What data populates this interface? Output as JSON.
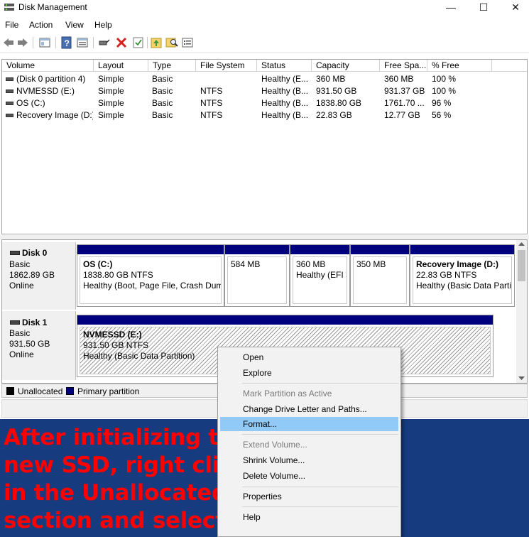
{
  "window": {
    "title": "Disk Management",
    "minimize": "—",
    "maximize": "☐",
    "close": "✕"
  },
  "menu": [
    "File",
    "Action",
    "View",
    "Help"
  ],
  "toolbar": {
    "icons": [
      "back-arrow-icon",
      "forward-arrow-icon",
      "show-hide-console-icon",
      "help-icon",
      "properties-icon",
      "connect-icon",
      "delete-icon",
      "check-icon",
      "up-arrow-icon",
      "search-icon",
      "list-icon"
    ]
  },
  "volume_table": {
    "columns": [
      "Volume",
      "Layout",
      "Type",
      "File System",
      "Status",
      "Capacity",
      "Free Spa...",
      "% Free"
    ],
    "rows": [
      [
        "(Disk 0 partition 4)",
        "Simple",
        "Basic",
        "",
        "Healthy (E...",
        "360 MB",
        "360 MB",
        "100 %"
      ],
      [
        "NVMESSD (E:)",
        "Simple",
        "Basic",
        "NTFS",
        "Healthy (B...",
        "931.50 GB",
        "931.37 GB",
        "100 %"
      ],
      [
        "OS (C:)",
        "Simple",
        "Basic",
        "NTFS",
        "Healthy (B...",
        "1838.80 GB",
        "1761.70 ...",
        "96 %"
      ],
      [
        "Recovery Image (D:)",
        "Simple",
        "Basic",
        "NTFS",
        "Healthy (B...",
        "22.83 GB",
        "12.77 GB",
        "56 %"
      ]
    ]
  },
  "disks": [
    {
      "name": "Disk 0",
      "type": "Basic",
      "size": "1862.89 GB",
      "state": "Online",
      "partitions": [
        {
          "line1": "OS  (C:)",
          "line2": "1838.80 GB NTFS",
          "line3": "Healthy (Boot, Page File, Crash Dump"
        },
        {
          "line1": "",
          "line2": "584 MB",
          "line3": ""
        },
        {
          "line1": "",
          "line2": "360 MB",
          "line3": "Healthy (EFI S"
        },
        {
          "line1": "",
          "line2": "350 MB",
          "line3": ""
        },
        {
          "line1": "Recovery Image  (D:)",
          "line2": "22.83 GB NTFS",
          "line3": "Healthy (Basic Data Partit"
        }
      ]
    },
    {
      "name": "Disk 1",
      "type": "Basic",
      "size": "931.50 GB",
      "state": "Online",
      "partitions": [
        {
          "line1": "NVMESSD  (E:)",
          "line2": "931.50 GB NTFS",
          "line3": "Healthy (Basic Data Partition)"
        }
      ]
    }
  ],
  "legend": {
    "unallocated": "Unallocated",
    "primary": "Primary partition",
    "unallocated_color": "#000000",
    "primary_color": "#00007e"
  },
  "context_menu": [
    {
      "label": "Open",
      "enabled": true
    },
    {
      "label": "Explore",
      "enabled": true
    },
    {
      "label": "Mark Partition as Active",
      "enabled": false
    },
    {
      "label": "Change Drive Letter and Paths...",
      "enabled": true
    },
    {
      "label": "Format...",
      "enabled": true,
      "highlighted": true
    },
    {
      "label": "Extend Volume...",
      "enabled": false
    },
    {
      "label": "Shrink Volume...",
      "enabled": true
    },
    {
      "label": "Delete Volume...",
      "enabled": true
    },
    {
      "label": "Properties",
      "enabled": true
    },
    {
      "label": "Help",
      "enabled": true
    }
  ],
  "caption": {
    "lines": [
      "After initializing the",
      "new SSD, right click",
      "in the Unallocated",
      "section and select Format."
    ],
    "text_color": "#ff0000",
    "background_color": "#163b7e"
  }
}
